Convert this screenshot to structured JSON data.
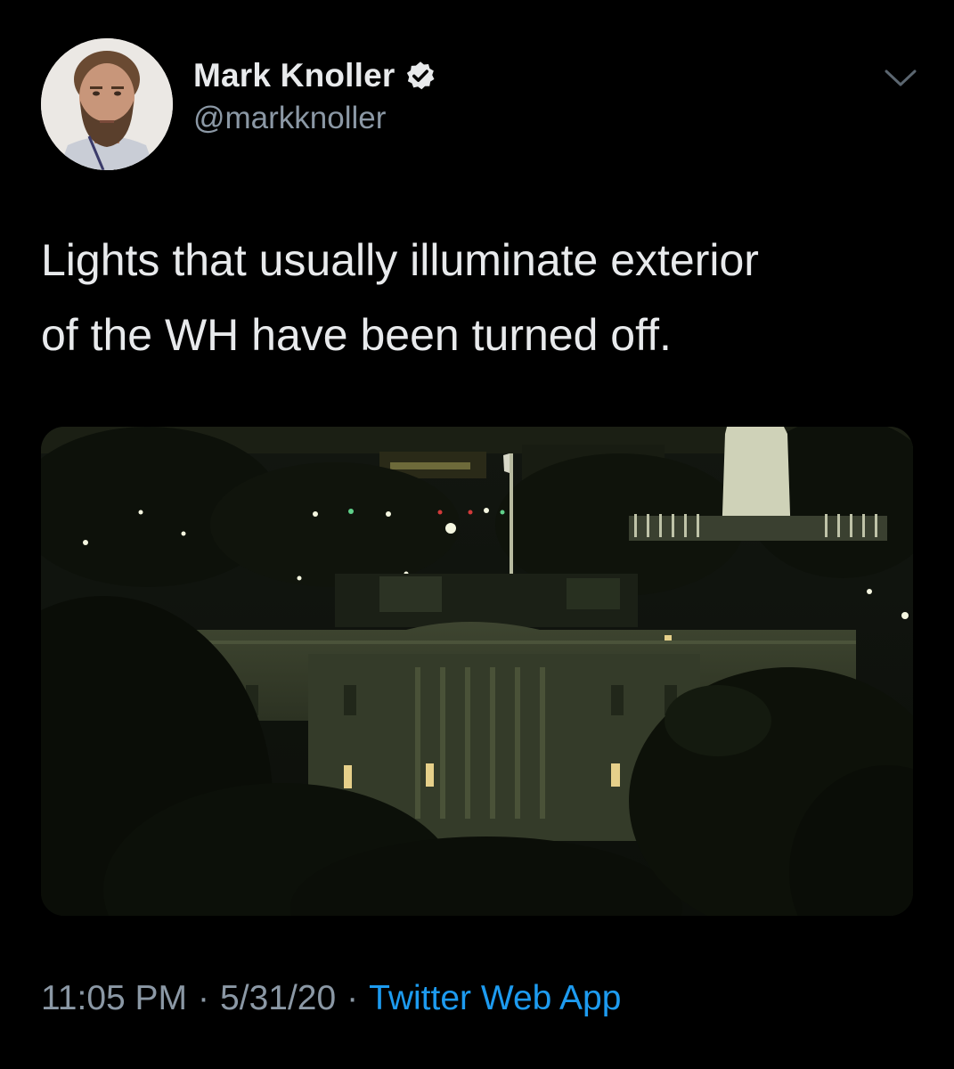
{
  "author": {
    "name": "Mark Knoller",
    "handle": "@markknoller",
    "verified": true
  },
  "tweet": {
    "text": "Lights that usually illuminate exterior\nof the WH have been turned off."
  },
  "meta": {
    "time": "11:05 PM",
    "separator": "·",
    "date": "5/31/20",
    "source": "Twitter Web App"
  },
  "icons": {
    "verified": "verified-badge-icon",
    "more": "chevron-down-icon"
  },
  "colors": {
    "background": "#000000",
    "text": "#e8eaec",
    "secondary": "#8b98a5",
    "link": "#1d9bf0"
  }
}
